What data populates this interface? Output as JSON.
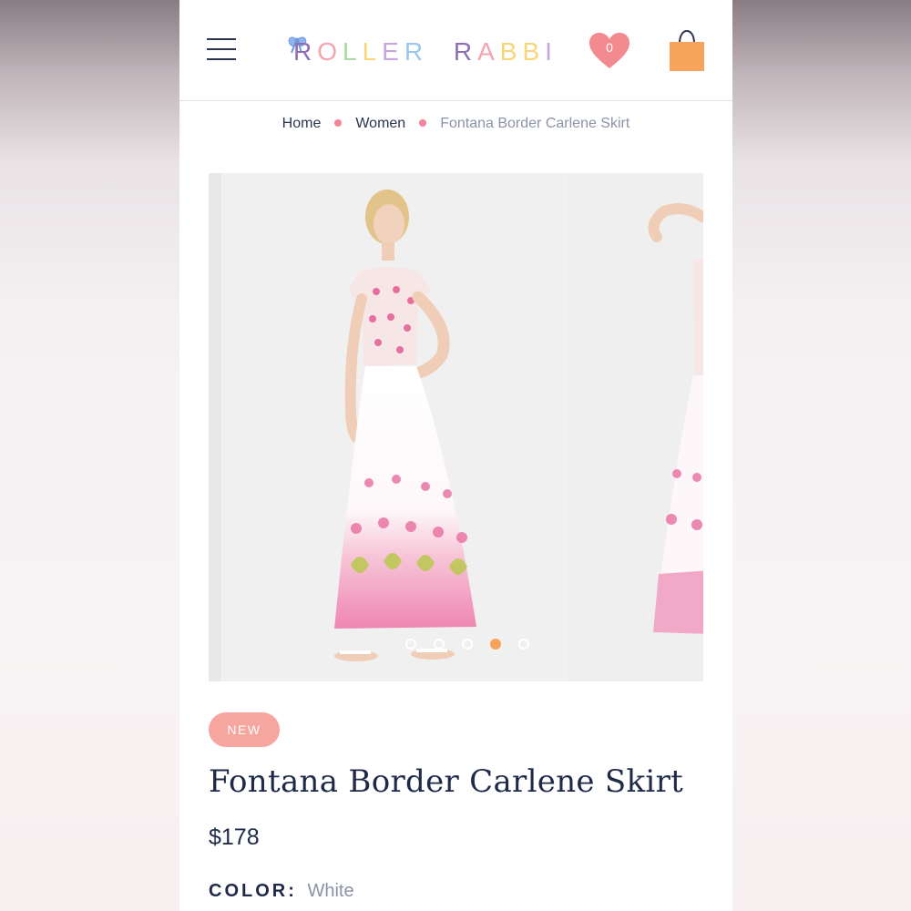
{
  "header": {
    "logo_text": "ROLLER RABBIT",
    "wishlist_count": "0"
  },
  "breadcrumb": {
    "items": [
      "Home",
      "Women",
      "Fontana Border Carlene Skirt"
    ]
  },
  "gallery": {
    "slide_count": 5,
    "active_index": 3
  },
  "product": {
    "badge": "NEW",
    "title": "Fontana Border Carlene Skirt",
    "price": "$178",
    "color_label": "COLOR:",
    "color_value": "White"
  },
  "colors": {
    "navy": "#1e2a47",
    "pink_accent": "#f3849a",
    "badge": "#f7a59f",
    "dot_active": "#f7a35c",
    "bag": "#f7a35c",
    "heart": "#f38a8f"
  },
  "icons": [
    "hamburger-menu-icon",
    "bow-icon",
    "heart-icon",
    "shopping-bag-icon"
  ]
}
